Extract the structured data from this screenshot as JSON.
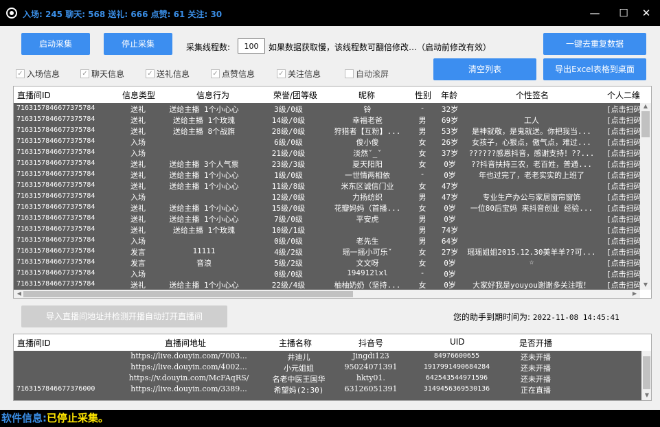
{
  "titlebar": {
    "stats": "入场: 245 聊天: 568 送礼: 666 点赞: 61 关注: 30",
    "min": "—",
    "max": "☐",
    "close": "✕"
  },
  "controls": {
    "start": "启动采集",
    "stop": "停止采集",
    "thread_label": "采集线程数:",
    "thread_value": "100",
    "thread_hint": "如果数据获取慢，该线程数可翻倍修改…（启动前修改有效）",
    "dedupe": "一键去重复数据",
    "clear": "清空列表",
    "export": "导出Excel表格到桌面"
  },
  "checkboxes": [
    {
      "label": "入场信息",
      "checked": true
    },
    {
      "label": "聊天信息",
      "checked": true
    },
    {
      "label": "送礼信息",
      "checked": true
    },
    {
      "label": "点赞信息",
      "checked": true
    },
    {
      "label": "关注信息",
      "checked": true
    },
    {
      "label": "自动滚屏",
      "checked": false
    }
  ],
  "grid1": {
    "headers": [
      "直播间ID",
      "信息类型",
      "信息行为",
      "荣誉/团等级",
      "昵称",
      "性别",
      "年龄",
      "个性签名",
      "个人二维"
    ],
    "rows": [
      {
        "id": "7163157846677375784",
        "type": "送礼",
        "act": "送给主播 1个小心心",
        "lvl": "3级/0级",
        "nick": "铃",
        "sex": "-",
        "age": "32岁",
        "sig": "",
        "qr": "[点击扫码"
      },
      {
        "id": "7163157846677375784",
        "type": "送礼",
        "act": "送给主播 1个玫瑰",
        "lvl": "14级/0级",
        "nick": "幸福老爸",
        "sex": "男",
        "age": "69岁",
        "sig": "工人",
        "qr": "[点击扫码"
      },
      {
        "id": "7163157846677375784",
        "type": "送礼",
        "act": "送给主播 8个战旗",
        "lvl": "28级/0级",
        "nick": "狩猎者【互粉】...",
        "sex": "男",
        "age": "53岁",
        "sig": "是神就敬，是鬼就送。你把我当...",
        "qr": "[点击扫码"
      },
      {
        "id": "7163157846677375784",
        "type": "入场",
        "act": "",
        "lvl": "6级/0级",
        "nick": "俊小俊",
        "sex": "女",
        "age": "26岁",
        "sig": "女孩子，心狠点，傲气点，难过...",
        "qr": "[点击扫码"
      },
      {
        "id": "7163157846677375784",
        "type": "入场",
        "act": "",
        "lvl": "21级/0级",
        "nick": "淡然ˇ_ˇ",
        "sex": "女",
        "age": "37岁",
        "sig": "??????感恩抖音，感谢支持！??...",
        "qr": "[点击扫码"
      },
      {
        "id": "7163157846677375784",
        "type": "送礼",
        "act": "送给主播 3个人气票",
        "lvl": "23级/3级",
        "nick": "夏天阳阳",
        "sex": "女",
        "age": "0岁",
        "sig": "??抖音扶持三农，老百姓，普通...",
        "qr": "[点击扫码"
      },
      {
        "id": "7163157846677375784",
        "type": "送礼",
        "act": "送给主播 1个小心心",
        "lvl": "1级/0级",
        "nick": "一世情两相依",
        "sex": "-",
        "age": "0岁",
        "sig": "年也过完了，老老实实的上班了",
        "qr": "[点击扫码"
      },
      {
        "id": "7163157846677375784",
        "type": "送礼",
        "act": "送给主播 1个小心心",
        "lvl": "11级/8级",
        "nick": "米东区诚信门业",
        "sex": "女",
        "age": "47岁",
        "sig": "",
        "qr": "[点击扫码"
      },
      {
        "id": "7163157846677375784",
        "type": "入场",
        "act": "",
        "lvl": "12级/0级",
        "nick": "力扬纺织",
        "sex": "男",
        "age": "47岁",
        "sig": "专业生产办公与家居窗帘窗饰",
        "qr": "[点击扫码"
      },
      {
        "id": "7163157846677375784",
        "type": "送礼",
        "act": "送给主播 1个小心心",
        "lvl": "15级/0级",
        "nick": "花瓣妈妈（首播...",
        "sex": "女",
        "age": "0岁",
        "sig": "一位80后宝妈 来抖音创业 经验...",
        "qr": "[点击扫码"
      },
      {
        "id": "7163157846677375784",
        "type": "送礼",
        "act": "送给主播 1个小心心",
        "lvl": "7级/0级",
        "nick": "平安虎",
        "sex": "男",
        "age": "0岁",
        "sig": "",
        "qr": "[点击扫码"
      },
      {
        "id": "7163157846677375784",
        "type": "送礼",
        "act": "送给主播 1个玫瑰",
        "lvl": "10级/1级",
        "nick": "",
        "sex": "男",
        "age": "74岁",
        "sig": "",
        "qr": "[点击扫码"
      },
      {
        "id": "7163157846677375784",
        "type": "入场",
        "act": "",
        "lvl": "0级/0级",
        "nick": "老先生",
        "sex": "男",
        "age": "64岁",
        "sig": "",
        "qr": "[点击扫码"
      },
      {
        "id": "7163157846677375784",
        "type": "发言",
        "act": "11111",
        "lvl": "4级/2级",
        "nick": "瑶一摇小可乐ˇ",
        "sex": "女",
        "age": "27岁",
        "sig": "瑶瑶姐姐2015.12.30美羊羊??可...",
        "qr": "[点击扫码"
      },
      {
        "id": "7163157846677375784",
        "type": "发言",
        "act": "音浪",
        "lvl": "5级/2级",
        "nick": "文文呀",
        "sex": "女",
        "age": "0岁",
        "sig": "☆",
        "qr": "[点击扫码"
      },
      {
        "id": "7163157846677375784",
        "type": "入场",
        "act": "",
        "lvl": "0级/0级",
        "nick": "194912lxl",
        "sex": "-",
        "age": "0岁",
        "sig": "",
        "qr": "[点击扫码"
      },
      {
        "id": "7163157846677375784",
        "type": "送礼",
        "act": "送给主播 1个小心心",
        "lvl": "22级/4级",
        "nick": "柚柚奶奶（坚持...",
        "sex": "女",
        "age": "0岁",
        "sig": "大家好我是youyou谢谢多关注哦！",
        "qr": "[点击扫码"
      }
    ]
  },
  "import_button": "导入直播间地址并检测开播自动打开直播间",
  "expire": {
    "label": "您的助手到期时间为:",
    "value": "2022-11-08 14:45:41"
  },
  "grid2": {
    "headers": [
      "直播间ID",
      "直播间地址",
      "主播名称",
      "抖音号",
      "UID",
      "是否开播"
    ],
    "rows": [
      {
        "id": "",
        "url": "https://live.douyin.com/7003...",
        "host": "井迪儿",
        "dy": "Jingdi123",
        "uid": "84976600655",
        "live": "还未开播"
      },
      {
        "id": "",
        "url": "https://live.douyin.com/4002...",
        "host": "小元姐姐",
        "dy": "95024071391",
        "uid": "1917991490684284",
        "live": "还未开播"
      },
      {
        "id": "",
        "url": "https://v.douyin.com/McFAqRS/",
        "host": "名老中医王国华",
        "dy": "hkty01.",
        "uid": "642543544971596",
        "live": "还未开播"
      },
      {
        "id": "7163157846677376000",
        "url": "https://live.douyin.com/3389...",
        "host": "希望妈(2:30)",
        "dy": "63126051391",
        "uid": "3149456369530136",
        "live": "正在直播"
      }
    ]
  },
  "status": {
    "label": "软件信息:",
    "value": "已停止采集。"
  }
}
